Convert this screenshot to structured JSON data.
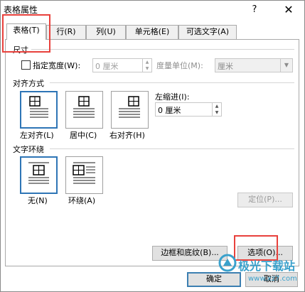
{
  "window": {
    "title": "表格属性",
    "help_label": "?",
    "close_label": "✕"
  },
  "tabs": [
    {
      "label": "表格(T)"
    },
    {
      "label": "行(R)"
    },
    {
      "label": "列(U)"
    },
    {
      "label": "单元格(E)"
    },
    {
      "label": "可选文字(A)"
    }
  ],
  "size": {
    "section_label": "尺寸",
    "specify_width_label": "指定宽度(W):",
    "width_value": "0 厘米",
    "unit_label": "度量单位(M):",
    "unit_value": "厘米"
  },
  "alignment": {
    "section_label": "对齐方式",
    "options": [
      {
        "label": "左对齐(L)"
      },
      {
        "label": "居中(C)"
      },
      {
        "label": "右对齐(H)"
      }
    ],
    "indent_label": "左缩进(I):",
    "indent_value": "0 厘米"
  },
  "wrap": {
    "section_label": "文字环绕",
    "options": [
      {
        "label": "无(N)"
      },
      {
        "label": "环绕(A)"
      }
    ],
    "position_button": "定位(P)..."
  },
  "buttons": {
    "borders": "边框和底纹(B)...",
    "options": "选项(O)...",
    "ok": "确定",
    "cancel": "取消"
  },
  "watermark": {
    "text": "极光下载站",
    "url": "www.xz7.com"
  },
  "colors": {
    "selection_border": "#2e75b6",
    "highlight": "#e8413c",
    "watermark": "#3aa1cc"
  }
}
